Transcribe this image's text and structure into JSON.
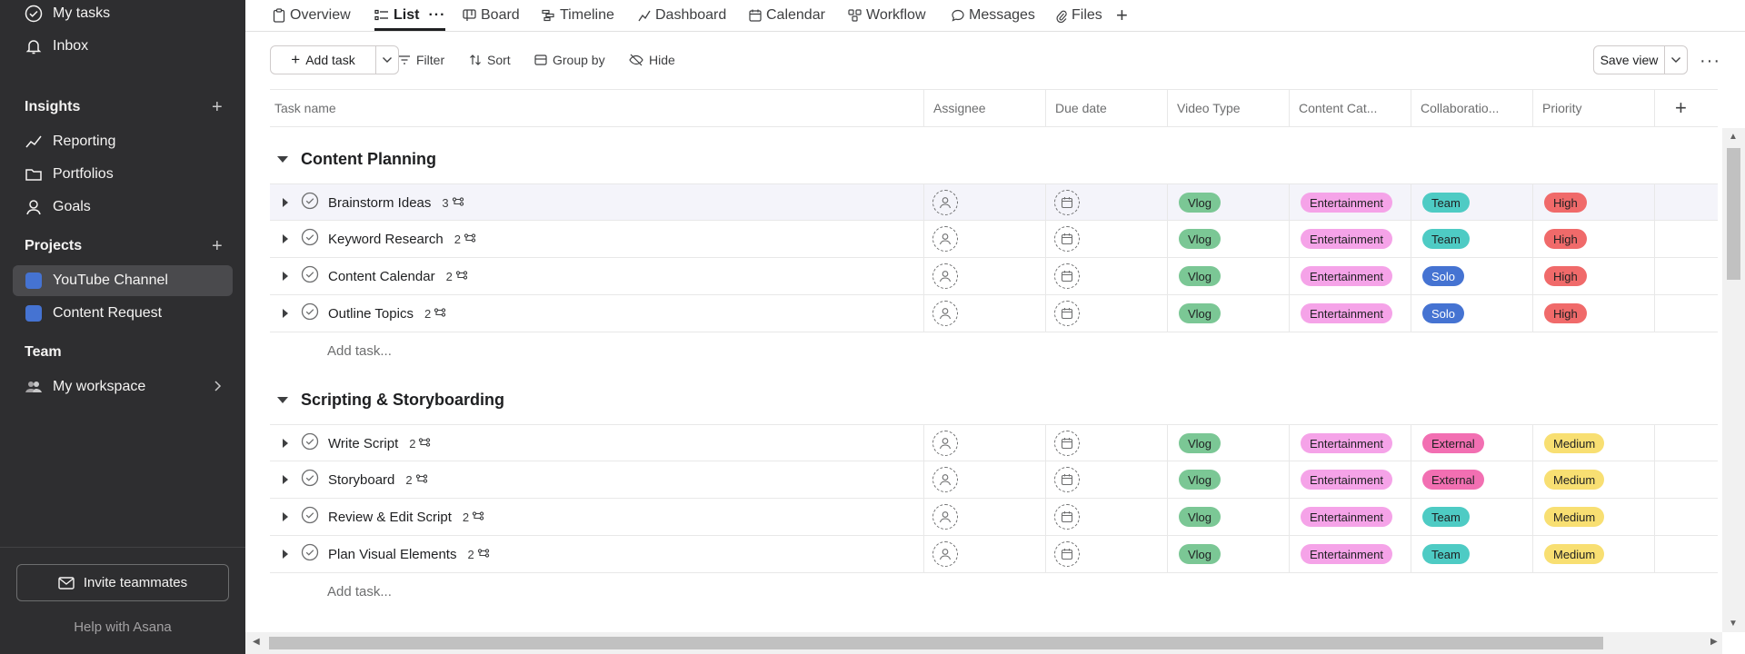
{
  "sidebar": {
    "top_items": [
      {
        "label": "My tasks",
        "icon": "check-circle-icon"
      },
      {
        "label": "Inbox",
        "icon": "bell-icon"
      }
    ],
    "insights_heading": "Insights",
    "insights": [
      {
        "label": "Reporting",
        "icon": "chart-line-icon"
      },
      {
        "label": "Portfolios",
        "icon": "folder-icon"
      },
      {
        "label": "Goals",
        "icon": "person-icon"
      }
    ],
    "projects_heading": "Projects",
    "projects": [
      {
        "label": "YouTube Channel",
        "color": "#4573d2",
        "active": true
      },
      {
        "label": "Content Request",
        "color": "#4573d2",
        "active": false
      }
    ],
    "team_heading": "Team",
    "team_item": "My workspace",
    "invite_label": "Invite teammates",
    "help_label": "Help with Asana"
  },
  "tabs": [
    {
      "label": "Overview",
      "icon": "clipboard-icon"
    },
    {
      "label": "List",
      "icon": "list-icon",
      "active": true
    },
    {
      "label": "Board",
      "icon": "board-icon"
    },
    {
      "label": "Timeline",
      "icon": "timeline-icon"
    },
    {
      "label": "Dashboard",
      "icon": "dashboard-icon"
    },
    {
      "label": "Calendar",
      "icon": "calendar-icon"
    },
    {
      "label": "Workflow",
      "icon": "workflow-icon"
    },
    {
      "label": "Messages",
      "icon": "message-icon"
    },
    {
      "label": "Files",
      "icon": "paperclip-icon"
    }
  ],
  "toolbar": {
    "add_task": "Add task",
    "filter": "Filter",
    "sort": "Sort",
    "group_by": "Group by",
    "hide": "Hide",
    "save_view": "Save view"
  },
  "columns": [
    "Task name",
    "Assignee",
    "Due date",
    "Video Type",
    "Content Cat...",
    "Collaboratio...",
    "Priority"
  ],
  "sections": [
    {
      "title": "Content Planning",
      "tasks": [
        {
          "name": "Brainstorm Ideas",
          "subtasks": "3",
          "video_type": "Vlog",
          "category": "Entertainment",
          "collab": "Team",
          "priority": "High",
          "highlight": true
        },
        {
          "name": "Keyword Research",
          "subtasks": "2",
          "video_type": "Vlog",
          "category": "Entertainment",
          "collab": "Team",
          "priority": "High"
        },
        {
          "name": "Content Calendar",
          "subtasks": "2",
          "video_type": "Vlog",
          "category": "Entertainment",
          "collab": "Solo",
          "priority": "High"
        },
        {
          "name": "Outline Topics",
          "subtasks": "2",
          "video_type": "Vlog",
          "category": "Entertainment",
          "collab": "Solo",
          "priority": "High"
        }
      ],
      "add_task": "Add task..."
    },
    {
      "title": "Scripting & Storyboarding",
      "tasks": [
        {
          "name": "Write Script",
          "subtasks": "2",
          "video_type": "Vlog",
          "category": "Entertainment",
          "collab": "External",
          "priority": "Medium"
        },
        {
          "name": "Storyboard",
          "subtasks": "2",
          "video_type": "Vlog",
          "category": "Entertainment",
          "collab": "External",
          "priority": "Medium"
        },
        {
          "name": "Review & Edit Script",
          "subtasks": "2",
          "video_type": "Vlog",
          "category": "Entertainment",
          "collab": "Team",
          "priority": "Medium"
        },
        {
          "name": "Plan Visual Elements",
          "subtasks": "2",
          "video_type": "Vlog",
          "category": "Entertainment",
          "collab": "Team",
          "priority": "Medium"
        }
      ],
      "add_task": "Add task..."
    }
  ],
  "pill_colors": {
    "Vlog": "#7bc795",
    "Entertainment": "#f5a3e8",
    "Team": "#4ecbc4",
    "Solo": "#4573d2",
    "External": "#f26fb2",
    "High": "#f06a6a",
    "Medium": "#f8df72"
  }
}
